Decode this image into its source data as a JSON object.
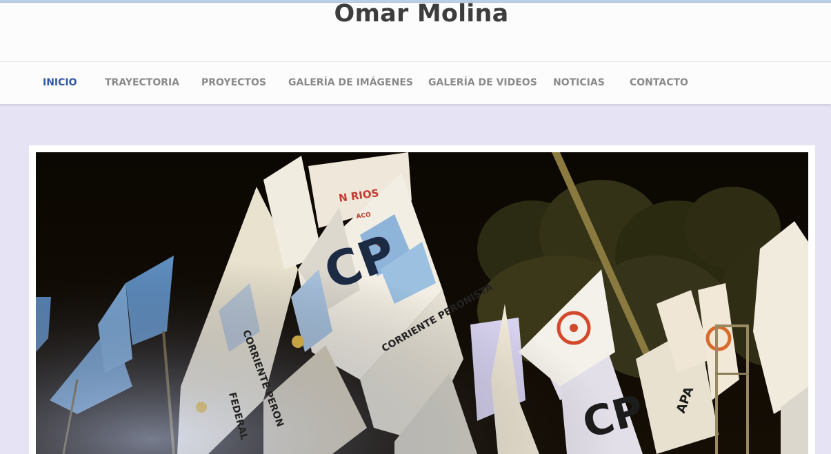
{
  "site": {
    "title": "Omar Molina"
  },
  "nav": {
    "items": [
      {
        "label": "INICIO",
        "active": true
      },
      {
        "label": "TRAYECTORIA",
        "active": false
      },
      {
        "label": "PROYECTOS",
        "active": false
      },
      {
        "label": "GALERÍA DE IMÁGENES",
        "active": false
      },
      {
        "label": "GALERÍA DE VIDEOS",
        "active": false
      },
      {
        "label": "NOTICIAS",
        "active": false
      },
      {
        "label": "CONTACTO",
        "active": false
      }
    ]
  },
  "hero": {
    "flag_texts": {
      "rios": "N RIOS",
      "aco": "ACO",
      "cp_main": "CP",
      "corriente_peronista": "CORRIENTE PERONISTA",
      "corriente_side": "CORRIENTE PERON",
      "federal": "FEDERAL",
      "cp_right": "CP",
      "apa": "APA"
    }
  },
  "colors": {
    "background": "#e5e3f4",
    "header": "#fcfcfc",
    "nav_active": "#2f57a6",
    "nav_inactive": "#8a8a8a",
    "title": "#3d3d3d"
  }
}
